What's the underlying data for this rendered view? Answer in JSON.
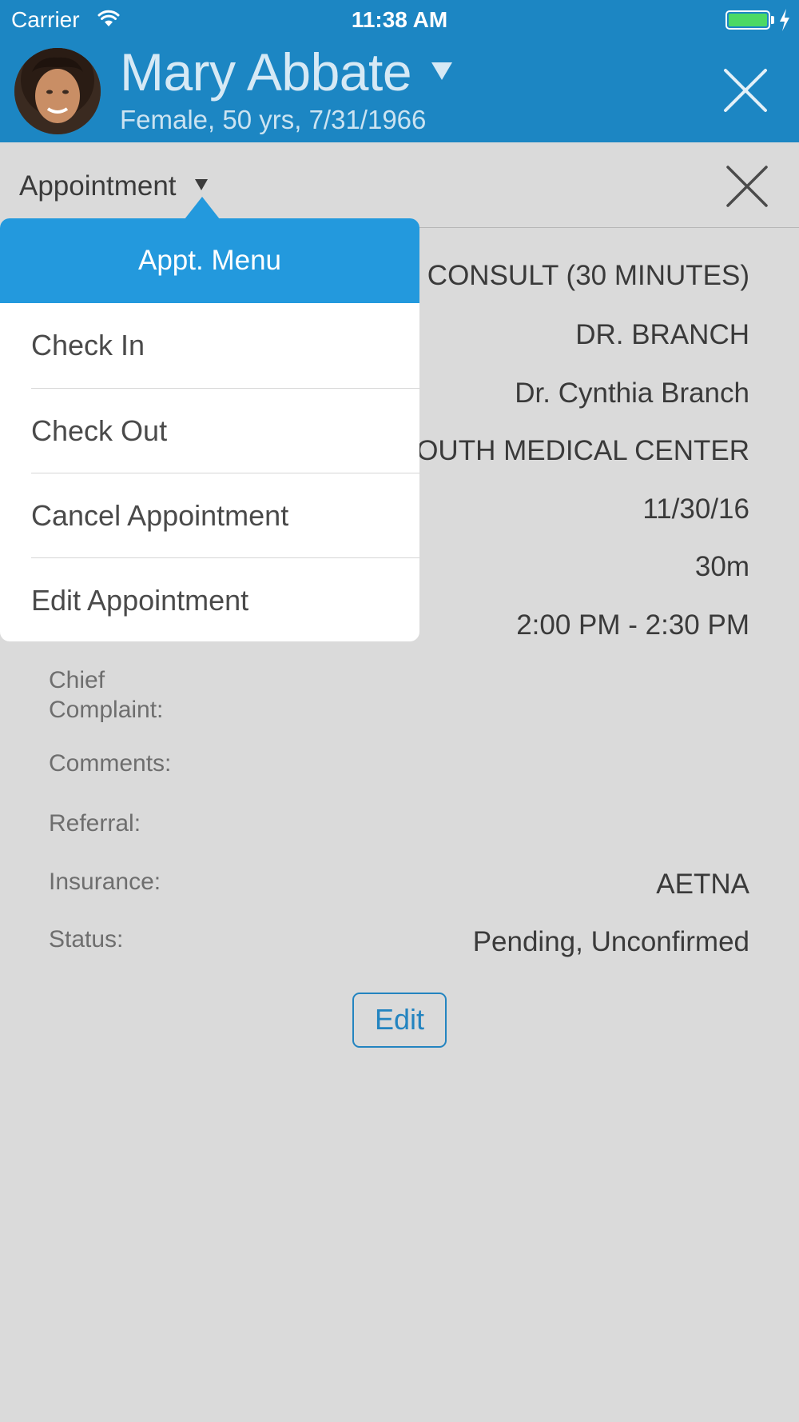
{
  "status_bar": {
    "carrier": "Carrier",
    "time": "11:38 AM",
    "battery_color": "#4cd964"
  },
  "patient": {
    "name": "Mary Abbate",
    "info": "Female, 50 yrs, 7/31/1966",
    "avatar_icon": "patient-photo",
    "header_color": "#1c86c3"
  },
  "appointment_bar": {
    "title": "Appointment"
  },
  "appt_menu": {
    "title": "Appt. Menu",
    "items": [
      {
        "label": "Check In"
      },
      {
        "label": "Check Out"
      },
      {
        "label": "Cancel Appointment"
      },
      {
        "label": "Edit Appointment"
      }
    ],
    "accent_color": "#2399dd"
  },
  "details": {
    "type": "CONSULT (30 MINUTES)",
    "provider_code": "DR. BRANCH",
    "provider_name": "Dr. Cynthia Branch",
    "location": "OUTH MEDICAL CENTER",
    "date": "11/30/16",
    "duration": "30m",
    "time_range": "2:00 PM - 2:30 PM",
    "chief_complaint_label": "Chief Complaint:",
    "comments_label": "Comments:",
    "referral_label": "Referral:",
    "insurance_label": "Insurance:",
    "insurance_value": "AETNA",
    "status_label": "Status:",
    "status_value": "Pending, Unconfirmed"
  },
  "edit_button": {
    "label": "Edit"
  }
}
